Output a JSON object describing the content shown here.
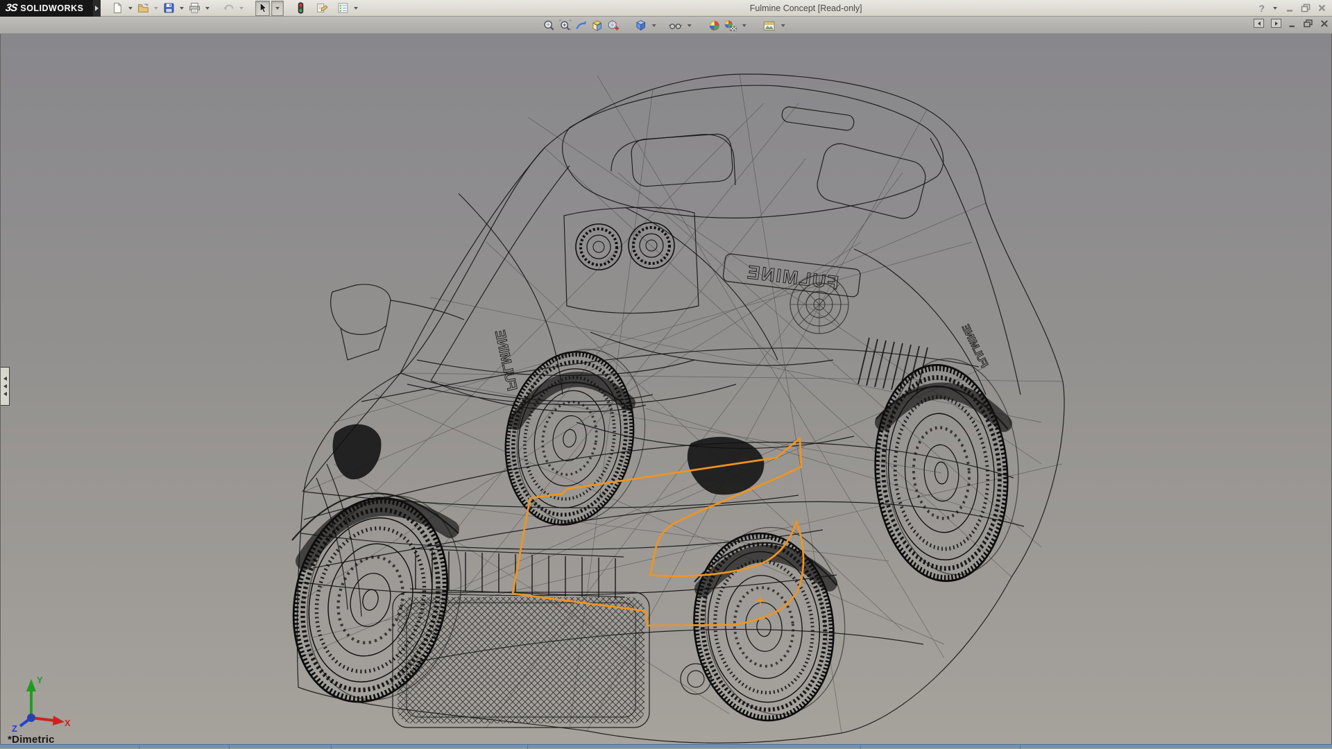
{
  "window": {
    "brand_mark": "3S",
    "brand": "SOLIDWORKS",
    "title": "Fulmine Concept [Read-only]",
    "help_glyph": "?"
  },
  "toolbars": {
    "standard": [
      "new-document",
      "open",
      "save",
      "print",
      "undo",
      "select",
      "rebuild-traffic-light",
      "file-properties",
      "options"
    ],
    "heads_up": [
      "zoom-to-fit",
      "zoom-to-area",
      "previous-view",
      "section-view",
      "view-orientation",
      "display-style",
      "hide-show-items",
      "edit-appearance",
      "apply-scene",
      "view-settings"
    ]
  },
  "document_controls": [
    "previous-window",
    "next-window",
    "minimize-document",
    "restore-document",
    "close-document"
  ],
  "viewport": {
    "view_orientation_label": "*Dimetric",
    "triad": {
      "x": "X",
      "y": "Y",
      "z": "Z"
    },
    "decal_text": "FULMINE",
    "sketch_color": "#F0941E",
    "background_top": "#88878C",
    "background_bottom": "#A6A29C",
    "status_bar_color": "#7291BA",
    "wireframe_color": "#111111"
  }
}
